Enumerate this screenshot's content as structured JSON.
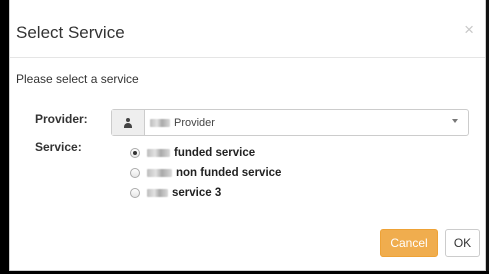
{
  "dialog": {
    "title": "Select Service",
    "close_glyph": "×",
    "prompt": "Please select a service"
  },
  "form": {
    "provider_label": "Provider:",
    "provider_icon": "user-icon",
    "provider_value": "Provider",
    "service_label": "Service:",
    "services": [
      {
        "label": "funded service",
        "checked": true
      },
      {
        "label": "non funded service",
        "checked": false
      },
      {
        "label": "service 3",
        "checked": false
      }
    ]
  },
  "footer": {
    "cancel_label": "Cancel",
    "ok_label": "OK"
  },
  "colors": {
    "cancel_bg": "#f0ad4e",
    "ok_bg": "#ffffff",
    "text": "#333333"
  }
}
